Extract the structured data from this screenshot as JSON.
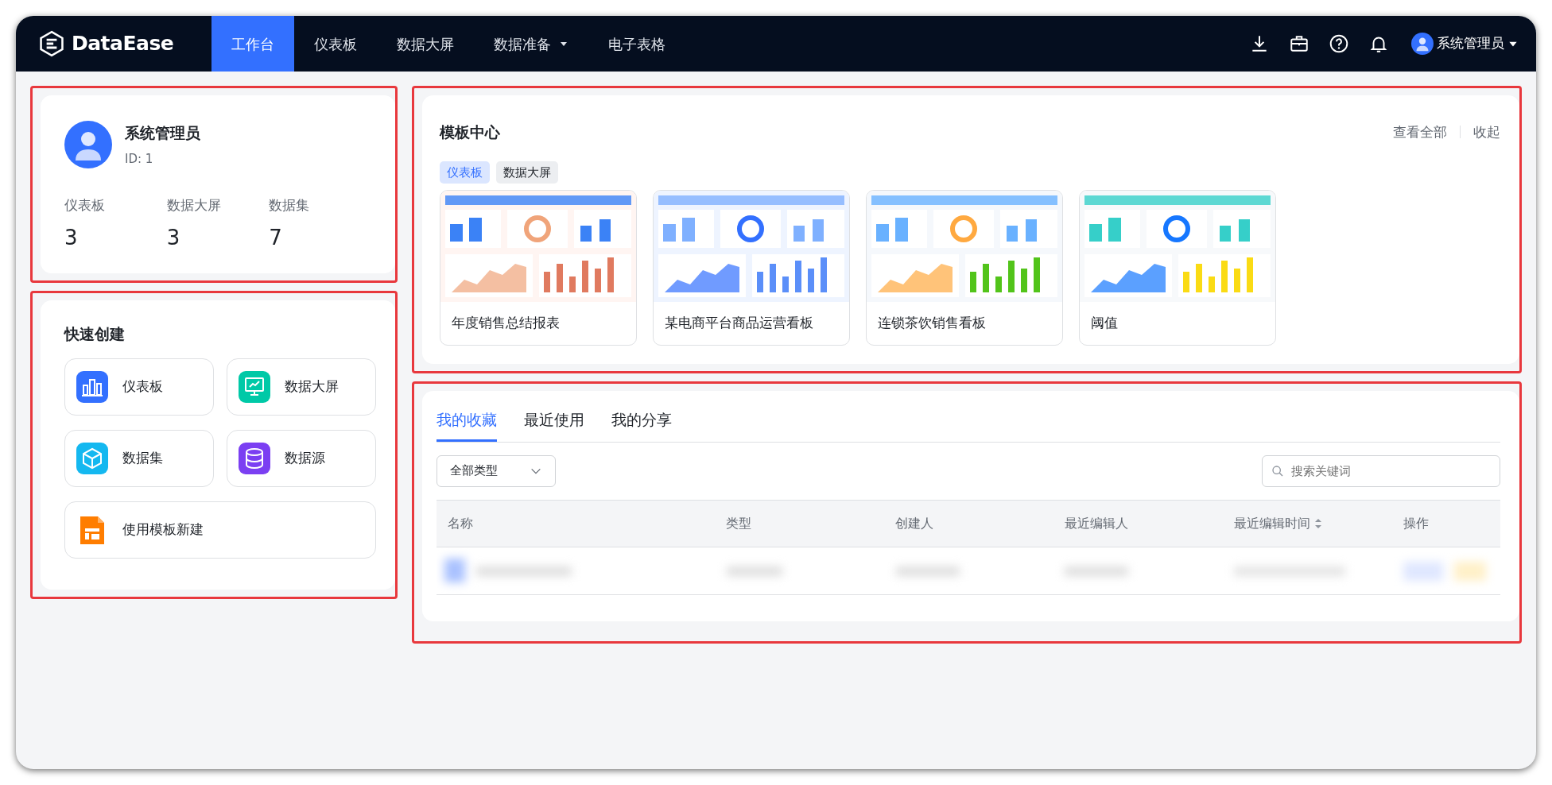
{
  "nav": {
    "logo": "DataEase",
    "items": [
      {
        "label": "工作台",
        "selected": true,
        "dropdown": false
      },
      {
        "label": "仪表板",
        "selected": false,
        "dropdown": false
      },
      {
        "label": "数据大屏",
        "selected": false,
        "dropdown": false
      },
      {
        "label": "数据准备",
        "selected": false,
        "dropdown": true
      },
      {
        "label": "电子表格",
        "selected": false,
        "dropdown": false
      }
    ],
    "tools": [
      {
        "kind": "download"
      },
      {
        "kind": "toolbox"
      },
      {
        "kind": "help"
      },
      {
        "kind": "bell"
      }
    ],
    "user": "系统管理员"
  },
  "profile": {
    "highlighted": true,
    "name": "系统管理员",
    "id": "ID: 1",
    "stats": [
      {
        "label": "仪表板",
        "value": "3"
      },
      {
        "label": "数据大屏",
        "value": "3"
      },
      {
        "label": "数据集",
        "value": "7"
      }
    ]
  },
  "quick_create": {
    "highlighted": true,
    "title": "快速创建",
    "items": [
      {
        "kind": "dashboard",
        "label": "仪表板"
      },
      {
        "kind": "screen",
        "label": "数据大屏"
      },
      {
        "kind": "dataset",
        "label": "数据集"
      },
      {
        "kind": "datasource",
        "label": "数据源"
      },
      {
        "kind": "template",
        "label": "使用模板新建"
      }
    ]
  },
  "templates": {
    "highlighted": true,
    "title": "模板中心",
    "links": [
      "查看全部",
      "收起"
    ],
    "filters": [
      {
        "label": "仪表板",
        "selected": true
      },
      {
        "label": "数据大屏",
        "selected": false
      }
    ],
    "cards": [
      {
        "title": "年度销售总结报表",
        "kind": "picture"
      },
      {
        "title": "某电商平台商品运营看板",
        "kind": "picture"
      },
      {
        "title": "连锁茶饮销售看板",
        "kind": "picture"
      },
      {
        "title": "阈值",
        "kind": "picture"
      }
    ]
  },
  "recent": {
    "highlighted": true,
    "tabs": [
      {
        "label": "我的收藏",
        "selected": true
      },
      {
        "label": "最近使用",
        "selected": false
      },
      {
        "label": "我的分享",
        "selected": false
      }
    ],
    "type_select": "全部类型",
    "search": {
      "placeholder": "搜索关键词"
    },
    "table": {
      "columns": [
        {
          "label": "名称",
          "sortable": false
        },
        {
          "label": "类型",
          "sortable": false
        },
        {
          "label": "创建人",
          "sortable": false
        },
        {
          "label": "最近编辑人",
          "sortable": false
        },
        {
          "label": "最近编辑时间",
          "sortable": true
        },
        {
          "label": "操作",
          "sortable": false
        }
      ],
      "rows": [
        {
          "kind": "blurred"
        }
      ]
    }
  }
}
